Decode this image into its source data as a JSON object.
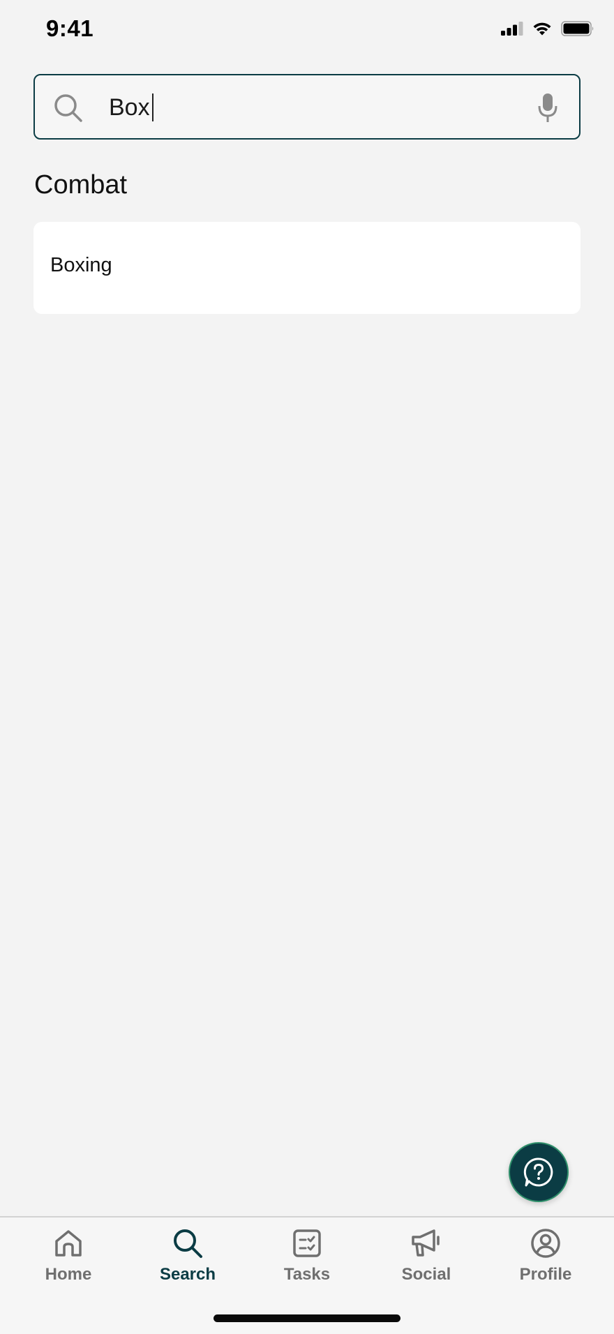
{
  "status_bar": {
    "time": "9:41"
  },
  "search": {
    "value": "Box",
    "icon": "search-icon",
    "mic_icon": "microphone-icon",
    "border_color": "#0b3c44"
  },
  "results": {
    "section_title": "Combat",
    "items": [
      {
        "label": "Boxing"
      }
    ]
  },
  "help": {
    "icon": "help-chat-icon",
    "color": "#0b3c44"
  },
  "tab_bar": {
    "active": "Search",
    "active_color": "#0b3c44",
    "inactive_color": "#6f6f6f",
    "tabs": [
      {
        "label": "Home",
        "icon": "home-icon"
      },
      {
        "label": "Search",
        "icon": "search-icon"
      },
      {
        "label": "Tasks",
        "icon": "tasks-icon"
      },
      {
        "label": "Social",
        "icon": "megaphone-icon"
      },
      {
        "label": "Profile",
        "icon": "profile-icon"
      }
    ]
  }
}
